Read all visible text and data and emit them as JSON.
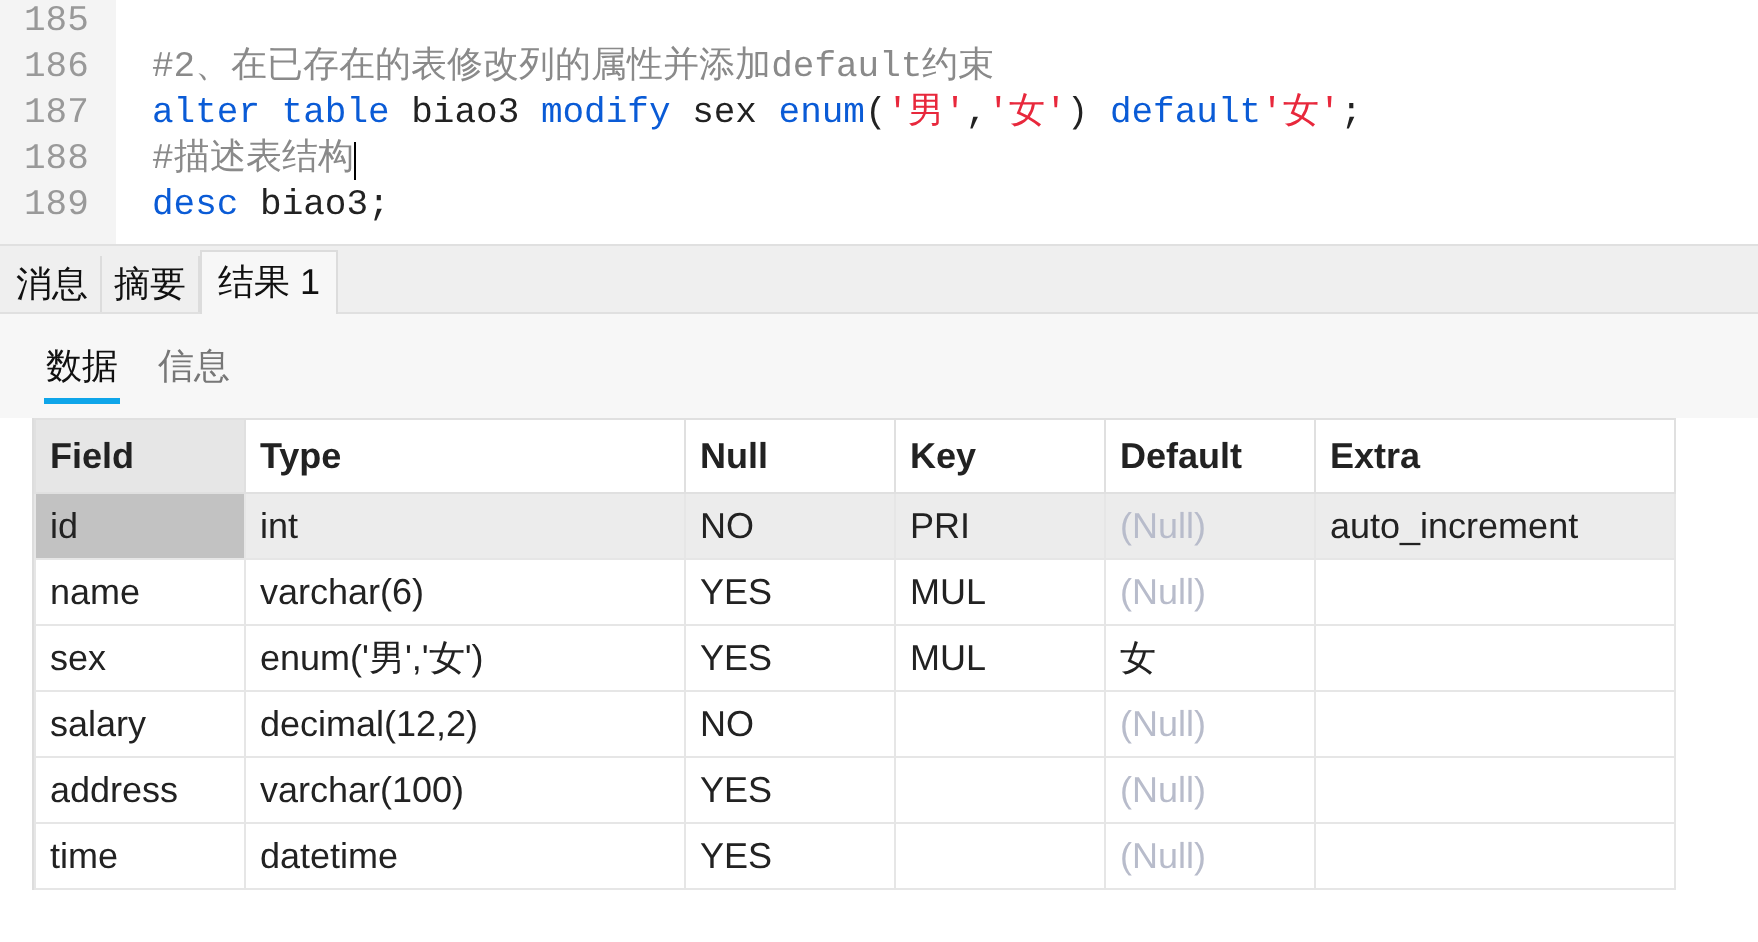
{
  "editor": {
    "lines": [
      {
        "number": "185"
      },
      {
        "number": "186",
        "tokens": [
          {
            "kind": "comment",
            "text": "#2、在已存在的表修改列的属性并添加default约束"
          }
        ]
      },
      {
        "number": "187",
        "tokens": [
          {
            "kind": "keyword",
            "text": "alter table"
          },
          {
            "kind": "plain",
            "text": " biao3 "
          },
          {
            "kind": "keyword",
            "text": "modify"
          },
          {
            "kind": "plain",
            "text": " sex "
          },
          {
            "kind": "keyword",
            "text": "enum"
          },
          {
            "kind": "plain",
            "text": "("
          },
          {
            "kind": "string",
            "text": "'男'"
          },
          {
            "kind": "plain",
            "text": ","
          },
          {
            "kind": "string",
            "text": "'女'"
          },
          {
            "kind": "plain",
            "text": ") "
          },
          {
            "kind": "keyword",
            "text": "default"
          },
          {
            "kind": "string",
            "text": "'女'"
          },
          {
            "kind": "plain",
            "text": ";"
          }
        ]
      },
      {
        "number": "188",
        "tokens": [
          {
            "kind": "comment",
            "text": "#描述表结构"
          }
        ],
        "cursor": true
      },
      {
        "number": "189",
        "tokens": [
          {
            "kind": "keyword",
            "text": "desc"
          },
          {
            "kind": "plain",
            "text": " biao3;"
          }
        ]
      }
    ]
  },
  "tabs": [
    {
      "label": "消息",
      "selected": false
    },
    {
      "label": "摘要",
      "selected": false
    },
    {
      "label": "结果 1",
      "selected": true
    }
  ],
  "subtabs": [
    {
      "label": "数据",
      "selected": true
    },
    {
      "label": "信息",
      "selected": false
    }
  ],
  "table": {
    "columns": [
      "Field",
      "Type",
      "Null",
      "Key",
      "Default",
      "Extra"
    ],
    "rows": [
      {
        "selected": true,
        "cells": [
          {
            "text": "id",
            "kind": "value"
          },
          {
            "text": "int",
            "kind": "value"
          },
          {
            "text": "NO",
            "kind": "value"
          },
          {
            "text": "PRI",
            "kind": "value"
          },
          {
            "text": "(Null)",
            "kind": "null"
          },
          {
            "text": "auto_increment",
            "kind": "value"
          }
        ]
      },
      {
        "selected": false,
        "cells": [
          {
            "text": "name",
            "kind": "value"
          },
          {
            "text": "varchar(6)",
            "kind": "value"
          },
          {
            "text": "YES",
            "kind": "value"
          },
          {
            "text": "MUL",
            "kind": "value"
          },
          {
            "text": "(Null)",
            "kind": "null"
          }
        ]
      },
      {
        "selected": false,
        "cells": [
          {
            "text": "sex",
            "kind": "value"
          },
          {
            "text": "enum('男','女')",
            "kind": "value"
          },
          {
            "text": "YES",
            "kind": "value"
          },
          {
            "text": "MUL",
            "kind": "value"
          },
          {
            "text": "女",
            "kind": "value"
          }
        ]
      },
      {
        "selected": false,
        "cells": [
          {
            "text": "salary",
            "kind": "value"
          },
          {
            "text": "decimal(12,2)",
            "kind": "value"
          },
          {
            "text": "NO",
            "kind": "value"
          },
          {},
          {
            "text": "(Null)",
            "kind": "null"
          }
        ]
      },
      {
        "selected": false,
        "cells": [
          {
            "text": "address",
            "kind": "value"
          },
          {
            "text": "varchar(100)",
            "kind": "value"
          },
          {
            "text": "YES",
            "kind": "value"
          },
          {},
          {
            "text": "(Null)",
            "kind": "null"
          }
        ]
      },
      {
        "selected": false,
        "cells": [
          {
            "text": "time",
            "kind": "value"
          },
          {
            "text": "datetime",
            "kind": "value"
          },
          {
            "text": "YES",
            "kind": "value"
          },
          {},
          {
            "text": "(Null)",
            "kind": "null"
          }
        ]
      }
    ]
  }
}
